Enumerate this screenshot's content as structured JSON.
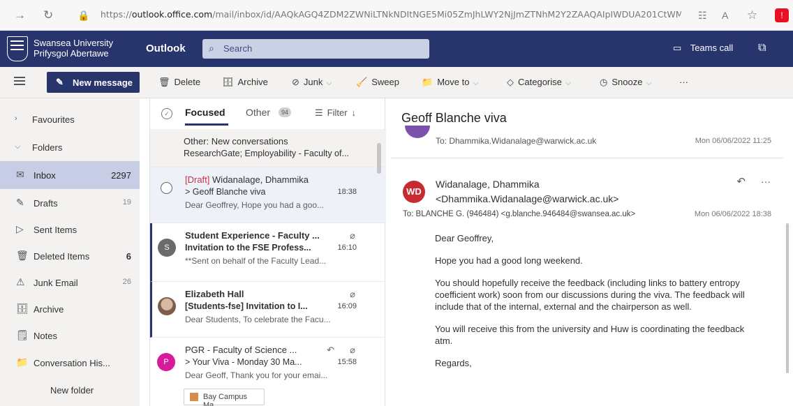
{
  "browser": {
    "url_prefix": "https://",
    "url_host": "outlook.office.com",
    "url_path": "/mail/inbox/id/AAQkAGQ4ZDM2ZWNiLTNkNDItNGE5Mi05ZmJhLWY2NjJmZTNhM2Y2ZAAQAIpIWDUA201CtWM...",
    "icons": {
      "back": "→",
      "reload": "↻",
      "site_info": "🔒",
      "reader": "☷",
      "read_aloud": "A",
      "favorite": "☆",
      "extension": "!"
    }
  },
  "header": {
    "org_line1": "Swansea University",
    "org_line2": "Prifysgol Abertawe",
    "app_name": "Outlook",
    "search_placeholder": "Search",
    "teams_call": "Teams call"
  },
  "toolbar": {
    "new_message": "New message",
    "actions": [
      {
        "name": "delete",
        "label": "Delete",
        "icon": "🗑"
      },
      {
        "name": "archive",
        "label": "Archive",
        "icon": "🗄"
      },
      {
        "name": "junk",
        "label": "Junk",
        "icon": "⊘"
      },
      {
        "name": "sweep",
        "label": "Sweep",
        "icon": "🧹"
      },
      {
        "name": "move-to",
        "label": "Move to",
        "icon": "📁"
      },
      {
        "name": "categorise",
        "label": "Categorise",
        "icon": "◇"
      },
      {
        "name": "snooze",
        "label": "Snooze",
        "icon": "◷"
      }
    ],
    "more": "···"
  },
  "sidebar": {
    "favourites": "Favourites",
    "folders": "Folders",
    "items": [
      {
        "label": "Inbox",
        "count": "2297",
        "icon": "✉"
      },
      {
        "label": "Drafts",
        "count": "19",
        "icon": "✎"
      },
      {
        "label": "Sent Items",
        "count": "",
        "icon": "▷"
      },
      {
        "label": "Deleted Items",
        "count": "6",
        "icon": "🗑"
      },
      {
        "label": "Junk Email",
        "count": "26",
        "icon": "⚠"
      },
      {
        "label": "Archive",
        "count": "",
        "icon": "🗄"
      },
      {
        "label": "Notes",
        "count": "",
        "icon": "🗒"
      },
      {
        "label": "Conversation His...",
        "count": "",
        "icon": "📁"
      }
    ],
    "new_folder": "New folder"
  },
  "message_list": {
    "tab_focused": "Focused",
    "tab_other": "Other",
    "other_count": "94",
    "filter": "Filter",
    "items": [
      {
        "line1": "Other: New conversations",
        "line2": "ResearchGate; Employability - Faculty of..."
      },
      {
        "draft_label": "[Draft]",
        "line1": "Widanalage, Dhammika",
        "line2": "> Geoff Blanche viva",
        "time": "18:38",
        "line3": "Dear Geoffrey, Hope you had a goo..."
      },
      {
        "avatar": "S",
        "line1": "Student Experience - Faculty ...",
        "line2": "Invitation to the FSE Profess...",
        "time": "16:10",
        "line3": "**Sent on behalf of the Faculty Lead..."
      },
      {
        "line1": "Elizabeth Hall",
        "line2": "[Students-fse] Invitation to I...",
        "time": "16:09",
        "line3": "Dear Students, To celebrate the Facu..."
      },
      {
        "avatar": "P",
        "line1": "PGR - Faculty of Science ...",
        "line2": "> Your Viva - Monday 30 Ma...",
        "time": "15:58",
        "line3": "Dear Geoff, Thank you for your emai...",
        "attachment": "Bay Campus Ma..."
      }
    ]
  },
  "reading": {
    "subject": "Geoff Blanche viva",
    "prev_to": "To: Dhammika.Widanalage@warwick.ac.uk",
    "prev_date": "Mon 06/06/2022 11:25",
    "initials": "WD",
    "sender": "Widanalage, Dhammika",
    "sender_email": "<Dhammika.Widanalage@warwick.ac.uk>",
    "to_line": "To:  BLANCHE G. (946484) <g.blanche.946484@swansea.ac.uk>",
    "date": "Mon 06/06/2022 18:38",
    "body": [
      "Dear Geoffrey,",
      "Hope you had a good long weekend.",
      "You should hopefully receive the feedback (including links to battery entropy coefficient work) soon from our discussions during the viva. The feedback will include that of the internal, external and the chairperson as well.",
      "You will receive this from the university and Huw is coordinating the feedback atm.",
      "Regards,"
    ]
  },
  "colors": {
    "header": "#28346c",
    "selected_nav": "#c7cde4",
    "avatar_s": "#6b6b6b",
    "avatar_p": "#d81b9a",
    "wd": "#c72a30"
  }
}
